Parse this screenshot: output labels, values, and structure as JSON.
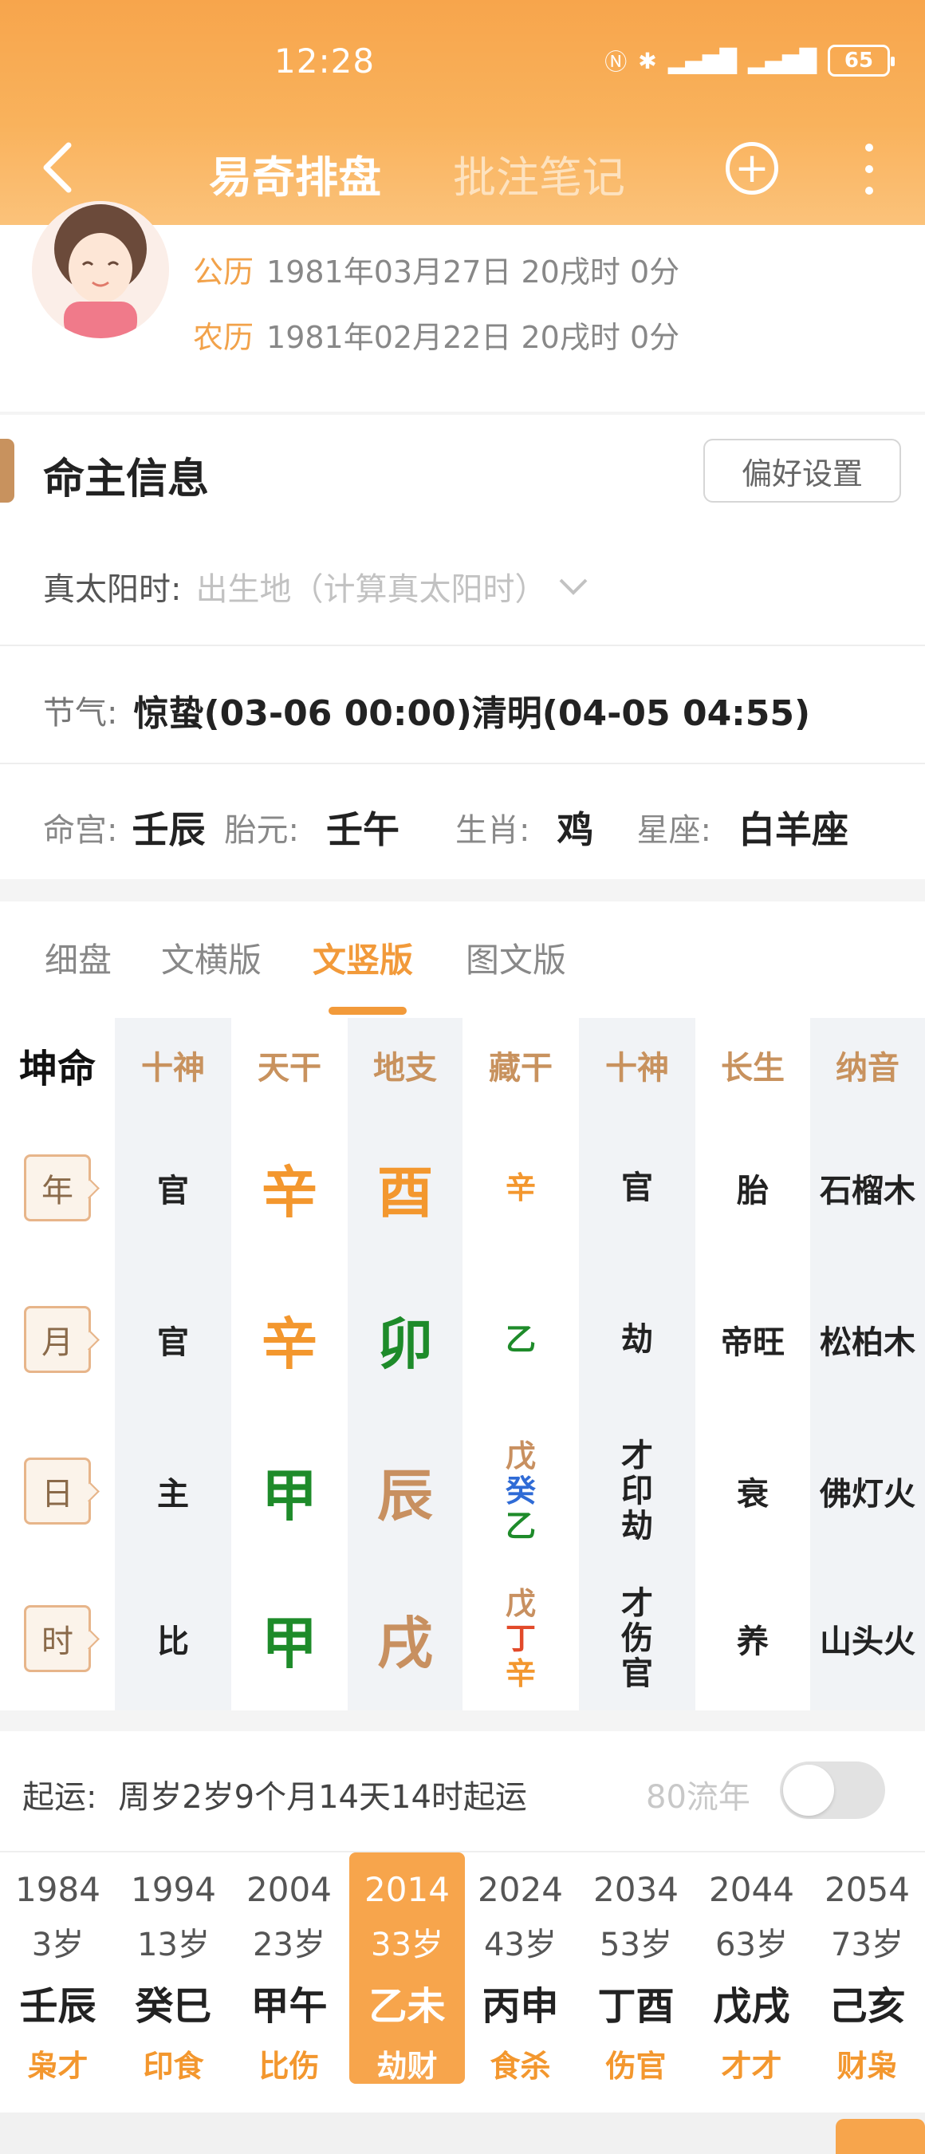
{
  "status": {
    "time": "12:28",
    "battery": "65"
  },
  "nav": {
    "tab_active": "易奇排盘",
    "tab_inactive": "批注笔记"
  },
  "profile": {
    "gregorian_label": "公历",
    "gregorian": "1981年03月27日 20戌时 0分",
    "lunar_label": "农历",
    "lunar": "1981年02月22日 20戌时 0分"
  },
  "info": {
    "title": "命主信息",
    "pref_button": "偏好设置",
    "solar_label": "真太阳时:",
    "solar_placeholder": "出生地（计算真太阳时）",
    "jieqi_label": "节气:",
    "jieqi_value": "惊蛰(03-06 00:00)清明(04-05 04:55)",
    "minggong_label": "命宫:",
    "minggong": "壬辰",
    "taiyuan_label": "胎元:",
    "taiyuan": "壬午",
    "shengxiao_label": "生肖:",
    "shengxiao": "鸡",
    "xingzuo_label": "星座:",
    "xingzuo": "白羊座"
  },
  "view_tabs": [
    "细盘",
    "文横版",
    "文竖版",
    "图文版"
  ],
  "chart": {
    "headers": [
      "坤命",
      "十神",
      "天干",
      "地支",
      "藏干",
      "十神",
      "长生",
      "纳音"
    ],
    "rows": [
      {
        "pillar": "年",
        "shishen": "官",
        "tiangan": "辛",
        "dizhi": "酉",
        "canggan": [
          "辛"
        ],
        "shishen2": [
          "官"
        ],
        "changsheng": "胎",
        "nayin": "石榴木"
      },
      {
        "pillar": "月",
        "shishen": "官",
        "tiangan": "辛",
        "dizhi": "卯",
        "canggan": [
          "乙"
        ],
        "shishen2": [
          "劫"
        ],
        "changsheng": "帝旺",
        "nayin": "松柏木"
      },
      {
        "pillar": "日",
        "shishen": "主",
        "tiangan": "甲",
        "dizhi": "辰",
        "canggan": [
          "戊",
          "癸",
          "乙"
        ],
        "shishen2": [
          "才",
          "印",
          "劫"
        ],
        "changsheng": "衰",
        "nayin": "佛灯火"
      },
      {
        "pillar": "时",
        "shishen": "比",
        "tiangan": "甲",
        "dizhi": "戌",
        "canggan": [
          "戊",
          "丁",
          "辛"
        ],
        "shishen2": [
          "才",
          "伤",
          "官"
        ],
        "changsheng": "养",
        "nayin": "山头火"
      }
    ]
  },
  "yun": {
    "label": "起运:",
    "text": "周岁2岁9个月14天14时起运",
    "liunian": "80流年",
    "dayun": [
      {
        "year": "1984",
        "age": "3岁",
        "ganzhi": "壬辰",
        "shishen": "枭才"
      },
      {
        "year": "1994",
        "age": "13岁",
        "ganzhi": "癸巳",
        "shishen": "印食"
      },
      {
        "year": "2004",
        "age": "23岁",
        "ganzhi": "甲午",
        "shishen": "比伤"
      },
      {
        "year": "2014",
        "age": "33岁",
        "ganzhi": "乙未",
        "shishen": "劫财"
      },
      {
        "year": "2024",
        "age": "43岁",
        "ganzhi": "丙申",
        "shishen": "食杀"
      },
      {
        "year": "2034",
        "age": "53岁",
        "ganzhi": "丁酉",
        "shishen": "伤官"
      },
      {
        "year": "2044",
        "age": "63岁",
        "ganzhi": "戊戌",
        "shishen": "才才"
      },
      {
        "year": "2054",
        "age": "73岁",
        "ganzhi": "己亥",
        "shishen": "财枭"
      }
    ]
  }
}
